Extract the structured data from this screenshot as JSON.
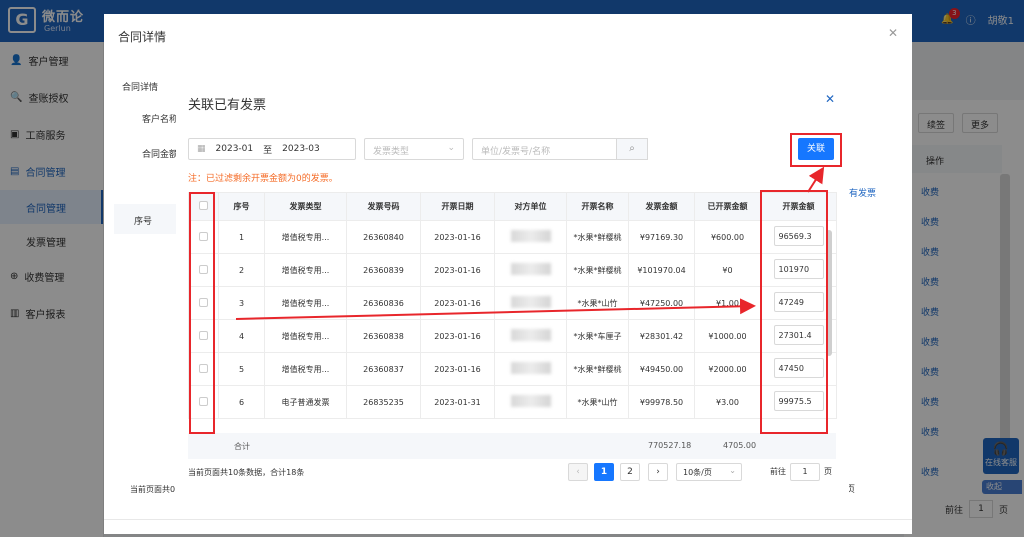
{
  "app": {
    "brand": "微而论",
    "brand_en": "Gerlun",
    "notif_count": "3",
    "user": "胡敬1"
  },
  "sidebar": {
    "items": [
      {
        "label": "客户管理"
      },
      {
        "label": "查账授权"
      },
      {
        "label": "工商服务"
      },
      {
        "label": "合同管理"
      },
      {
        "label": "合同管理"
      },
      {
        "label": "发票管理"
      },
      {
        "label": "收费管理"
      },
      {
        "label": "客户报表"
      }
    ]
  },
  "bg": {
    "btn_sign": "续签",
    "btn_more": "更多",
    "col_op": "操作",
    "link_fee": "收费",
    "help": "在线客服",
    "collapse": "收起",
    "goto": "前往",
    "goto_val": "1",
    "page_unit": "页",
    "add_invoice": "有发票"
  },
  "contract": {
    "title": "合同详情",
    "section": "合同详情",
    "customer_label": "客户名称",
    "amount_label": "合同金额",
    "col_index": "序号",
    "footer": "当前页面共0"
  },
  "invoice": {
    "title": "关联已有发票",
    "date_from": "2023-01",
    "date_sep": "至",
    "date_to": "2023-03",
    "type_placeholder": "发票类型",
    "search_placeholder": "单位/发票号/名称",
    "link_button": "关联",
    "note": "注：已过滤剩余开票金额为0的发票。",
    "columns": [
      "序号",
      "发票类型",
      "发票号码",
      "开票日期",
      "对方单位",
      "开票名称",
      "发票金额",
      "已开票金额",
      "开票金额"
    ],
    "rows": [
      {
        "idx": "1",
        "type": "增值税专用...",
        "no": "26360840",
        "date": "2023-01-16",
        "name": "*水果*鲜樱桃",
        "amount": "¥97169.30",
        "issued": "¥600.00",
        "input": "96569.3"
      },
      {
        "idx": "2",
        "type": "增值税专用...",
        "no": "26360839",
        "date": "2023-01-16",
        "name": "*水果*鲜樱桃",
        "amount": "¥101970.04",
        "issued": "¥0",
        "input": "101970"
      },
      {
        "idx": "3",
        "type": "增值税专用...",
        "no": "26360836",
        "date": "2023-01-16",
        "name": "*水果*山竹",
        "amount": "¥47250.00",
        "issued": "¥1.00",
        "input": "47249"
      },
      {
        "idx": "4",
        "type": "增值税专用...",
        "no": "26360838",
        "date": "2023-01-16",
        "name": "*水果*车厘子",
        "amount": "¥28301.42",
        "issued": "¥1000.00",
        "input": "27301.4"
      },
      {
        "idx": "5",
        "type": "增值税专用...",
        "no": "26360837",
        "date": "2023-01-16",
        "name": "*水果*鲜樱桃",
        "amount": "¥49450.00",
        "issued": "¥2000.00",
        "input": "47450"
      },
      {
        "idx": "6",
        "type": "电子普通发票",
        "no": "26835235",
        "date": "2023-01-31",
        "name": "*水果*山竹",
        "amount": "¥99978.50",
        "issued": "¥3.00",
        "input": "99975.5"
      }
    ],
    "sum_label": "合计",
    "sum_amount": "770527.18",
    "sum_issued": "4705.00",
    "pager_text": "当前页面共10条数据，合计18条",
    "page_prev": "‹",
    "page1": "1",
    "page2": "2",
    "page_next": "›",
    "page_size": "10条/页",
    "goto": "前往",
    "goto_val": "1",
    "page_unit": "页"
  }
}
